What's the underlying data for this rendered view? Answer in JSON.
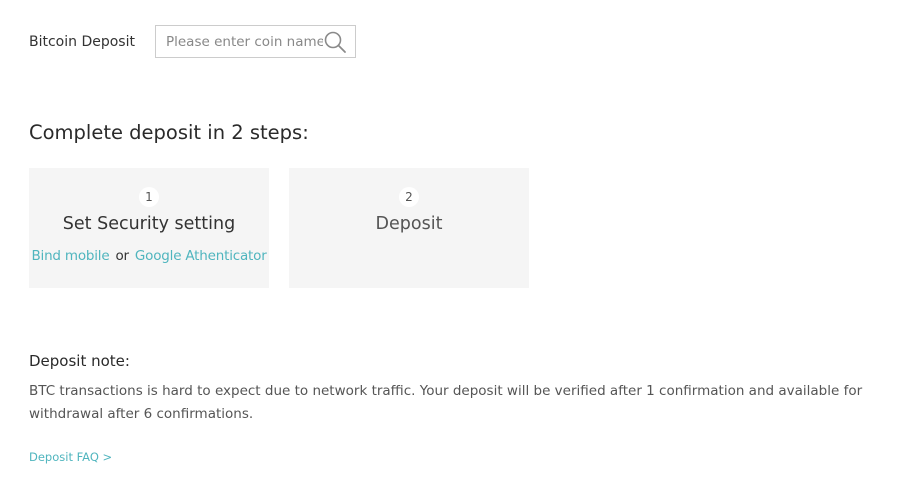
{
  "header": {
    "coin_name": "Bitcoin Deposit",
    "search": {
      "placeholder": "Please enter coin name",
      "value": "",
      "icon": "search-icon"
    }
  },
  "steps": {
    "title": "Complete deposit in 2 steps:",
    "items": [
      {
        "number": "1",
        "label": "Set Security setting",
        "links": {
          "bind_mobile": "Bind mobile",
          "separator": "or",
          "google_auth": "Google Athenticator"
        }
      },
      {
        "number": "2",
        "label": "Deposit"
      }
    ]
  },
  "note": {
    "title": "Deposit note:",
    "text": "BTC transactions is hard to expect due to network traffic. Your deposit will be verified after 1 confirmation and available for withdrawal after 6 confirmations."
  },
  "faq_link": "Deposit FAQ >",
  "colors": {
    "accent": "#4fb5be",
    "card_background": "#f5f5f5",
    "border": "#cccccc"
  }
}
